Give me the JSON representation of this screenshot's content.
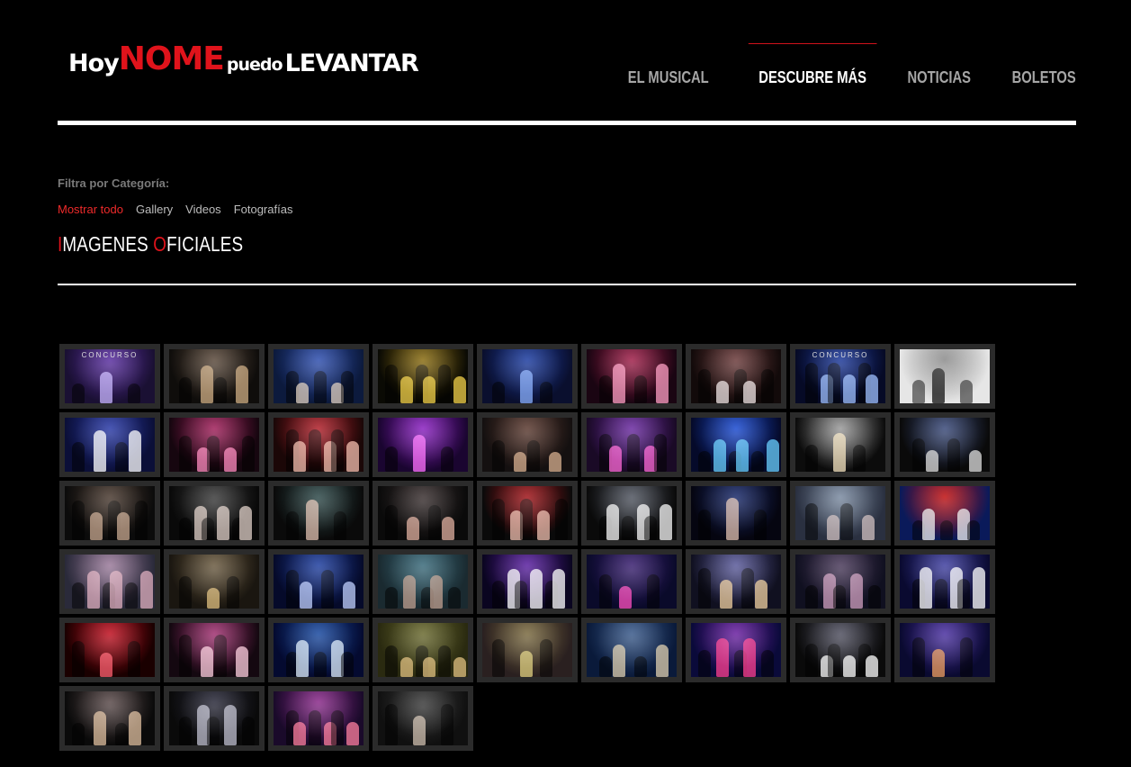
{
  "header": {
    "logo": {
      "parts": [
        {
          "text": "Hoy",
          "style": "white"
        },
        {
          "text": "NO",
          "style": "red-big"
        },
        {
          "text": "ME",
          "style": "red-big"
        },
        {
          "text": "puedo",
          "style": "white-small"
        },
        {
          "text": "LEVAN",
          "style": "white"
        },
        {
          "text": "TAR",
          "style": "white"
        }
      ],
      "icon": "dancer-silhouette-icon"
    },
    "nav": [
      {
        "label": "EL MUSICAL",
        "active": false
      },
      {
        "label": "DESCUBRE MÁS",
        "active": true
      },
      {
        "label": "NOTICIAS",
        "active": false
      },
      {
        "label": "BOLETOS",
        "active": false
      }
    ]
  },
  "filters": {
    "label": "Filtra por Categoría:",
    "options": [
      {
        "label": "Mostrar todo",
        "active": true
      },
      {
        "label": "Gallery",
        "active": false
      },
      {
        "label": "Videos",
        "active": false
      },
      {
        "label": "Fotografías",
        "active": false
      }
    ]
  },
  "section": {
    "title_parts": [
      {
        "text": "I",
        "red": true
      },
      {
        "text": "MAGENES ",
        "red": false
      },
      {
        "text": "O",
        "red": true
      },
      {
        "text": "FICIALES",
        "red": false
      }
    ]
  },
  "gallery": {
    "columns": 9,
    "thumbnails": [
      {
        "colors": [
          "#1a1033",
          "#5a2fa0",
          "#c8b6ff"
        ],
        "label": "CONCURSO"
      },
      {
        "colors": [
          "#0f0d0b",
          "#5b4a3c",
          "#cfae84"
        ],
        "label": ""
      },
      {
        "colors": [
          "#0c1a3d",
          "#2f4fae",
          "#e0d0c0"
        ],
        "label": ""
      },
      {
        "colors": [
          "#0a0a04",
          "#8a6d12",
          "#f3d24a"
        ],
        "label": ""
      },
      {
        "colors": [
          "#0a0f2e",
          "#1d3da0",
          "#8ab0ff"
        ],
        "label": ""
      },
      {
        "colors": [
          "#1a0512",
          "#a0204a",
          "#ff9fc4"
        ],
        "label": ""
      },
      {
        "colors": [
          "#120a0a",
          "#6b3b3b",
          "#f0e6e6"
        ],
        "label": ""
      },
      {
        "colors": [
          "#060a26",
          "#1e3a9a",
          "#9fc0ff"
        ],
        "label": "CONCURSO"
      },
      {
        "colors": [
          "#e6e6e6",
          "#8a8a8a",
          "#111111"
        ],
        "label": ""
      },
      {
        "colors": [
          "#0b0f38",
          "#2a3aa6",
          "#ffffff"
        ],
        "label": ""
      },
      {
        "colors": [
          "#16060f",
          "#a01f5a",
          "#ff8cc0"
        ],
        "label": ""
      },
      {
        "colors": [
          "#1b0707",
          "#b0202a",
          "#f6c0b0"
        ],
        "label": ""
      },
      {
        "colors": [
          "#1a0530",
          "#8a20c0",
          "#ff70ff"
        ],
        "label": ""
      },
      {
        "colors": [
          "#141010",
          "#5b3a30",
          "#d8b090"
        ],
        "label": ""
      },
      {
        "colors": [
          "#1a0a26",
          "#6a2aa0",
          "#ff6ad8"
        ],
        "label": ""
      },
      {
        "colors": [
          "#050a2a",
          "#1a4ad0",
          "#6ad0ff"
        ],
        "label": ""
      },
      {
        "colors": [
          "#0c0c0c",
          "#9a9a9a",
          "#f5e4c0"
        ],
        "label": ""
      },
      {
        "colors": [
          "#0a0a0a",
          "#3a4a7a",
          "#e0e0e0"
        ],
        "label": ""
      },
      {
        "colors": [
          "#0b0b0b",
          "#4a3a30",
          "#c8a890"
        ],
        "label": ""
      },
      {
        "colors": [
          "#090909",
          "#3a3a3a",
          "#e0d0c8"
        ],
        "label": ""
      },
      {
        "colors": [
          "#0a0a0a",
          "#2f4a4a",
          "#e0c0b0"
        ],
        "label": ""
      },
      {
        "colors": [
          "#0a0a0a",
          "#3a3030",
          "#e0b0a0"
        ],
        "label": ""
      },
      {
        "colors": [
          "#0a0a0a",
          "#a0151a",
          "#f0c0b0"
        ],
        "label": ""
      },
      {
        "colors": [
          "#0a0a0a",
          "#505560",
          "#f8f8f8"
        ],
        "label": ""
      },
      {
        "colors": [
          "#050510",
          "#1a2a6a",
          "#e0c0b0"
        ],
        "label": ""
      },
      {
        "colors": [
          "#2a3040",
          "#7a8aa0",
          "#d0c0c0"
        ],
        "label": ""
      },
      {
        "colors": [
          "#0a1a5a",
          "#c01010",
          "#f0f0f0"
        ],
        "label": ""
      },
      {
        "colors": [
          "#2a2a3a",
          "#9a7a9a",
          "#e0b0c0"
        ],
        "label": ""
      },
      {
        "colors": [
          "#1a1610",
          "#6a5a40",
          "#e0c080"
        ],
        "label": ""
      },
      {
        "colors": [
          "#050a2a",
          "#2040a0",
          "#c0d0ff"
        ],
        "label": ""
      },
      {
        "colors": [
          "#1a2a30",
          "#3a6a7a",
          "#c0a090"
        ],
        "label": ""
      },
      {
        "colors": [
          "#0a0520",
          "#5a20a0",
          "#ffffff"
        ],
        "label": ""
      },
      {
        "colors": [
          "#0a0a2a",
          "#3a2070",
          "#ff50c0"
        ],
        "label": ""
      },
      {
        "colors": [
          "#101020",
          "#5a5a9a",
          "#f0d0a0"
        ],
        "label": ""
      },
      {
        "colors": [
          "#101020",
          "#4a3a5a",
          "#d0a0c0"
        ],
        "label": ""
      },
      {
        "colors": [
          "#0a0a30",
          "#4040a0",
          "#ffffff"
        ],
        "label": ""
      },
      {
        "colors": [
          "#1a0000",
          "#c01020",
          "#ff6070"
        ],
        "label": ""
      },
      {
        "colors": [
          "#140810",
          "#a03070",
          "#ffd0e0"
        ],
        "label": ""
      },
      {
        "colors": [
          "#040a30",
          "#1a4aa0",
          "#e0f0ff"
        ],
        "label": ""
      },
      {
        "colors": [
          "#2a2a10",
          "#6a6a30",
          "#e0c080"
        ],
        "label": ""
      },
      {
        "colors": [
          "#2a2020",
          "#7a6a40",
          "#e0d080"
        ],
        "label": ""
      },
      {
        "colors": [
          "#0a1a3a",
          "#3a5a8a",
          "#e0d0b0"
        ],
        "label": ""
      },
      {
        "colors": [
          "#0a0a3a",
          "#6a20a0",
          "#ff4090"
        ],
        "label": ""
      },
      {
        "colors": [
          "#0a0a0a",
          "#505060",
          "#ffffff"
        ],
        "label": ""
      },
      {
        "colors": [
          "#0a0a30",
          "#4a30a0",
          "#f0a060"
        ],
        "label": ""
      },
      {
        "colors": [
          "#0a0a0a",
          "#5a4a4a",
          "#e0c0a0"
        ],
        "label": ""
      },
      {
        "colors": [
          "#0a0a0a",
          "#2a2a3a",
          "#c0c0d0"
        ],
        "label": ""
      },
      {
        "colors": [
          "#1a0a2a",
          "#8a2a8a",
          "#ff80a0"
        ],
        "label": ""
      },
      {
        "colors": [
          "#101010",
          "#3a3a3a",
          "#d0c0b0"
        ],
        "label": ""
      }
    ]
  }
}
